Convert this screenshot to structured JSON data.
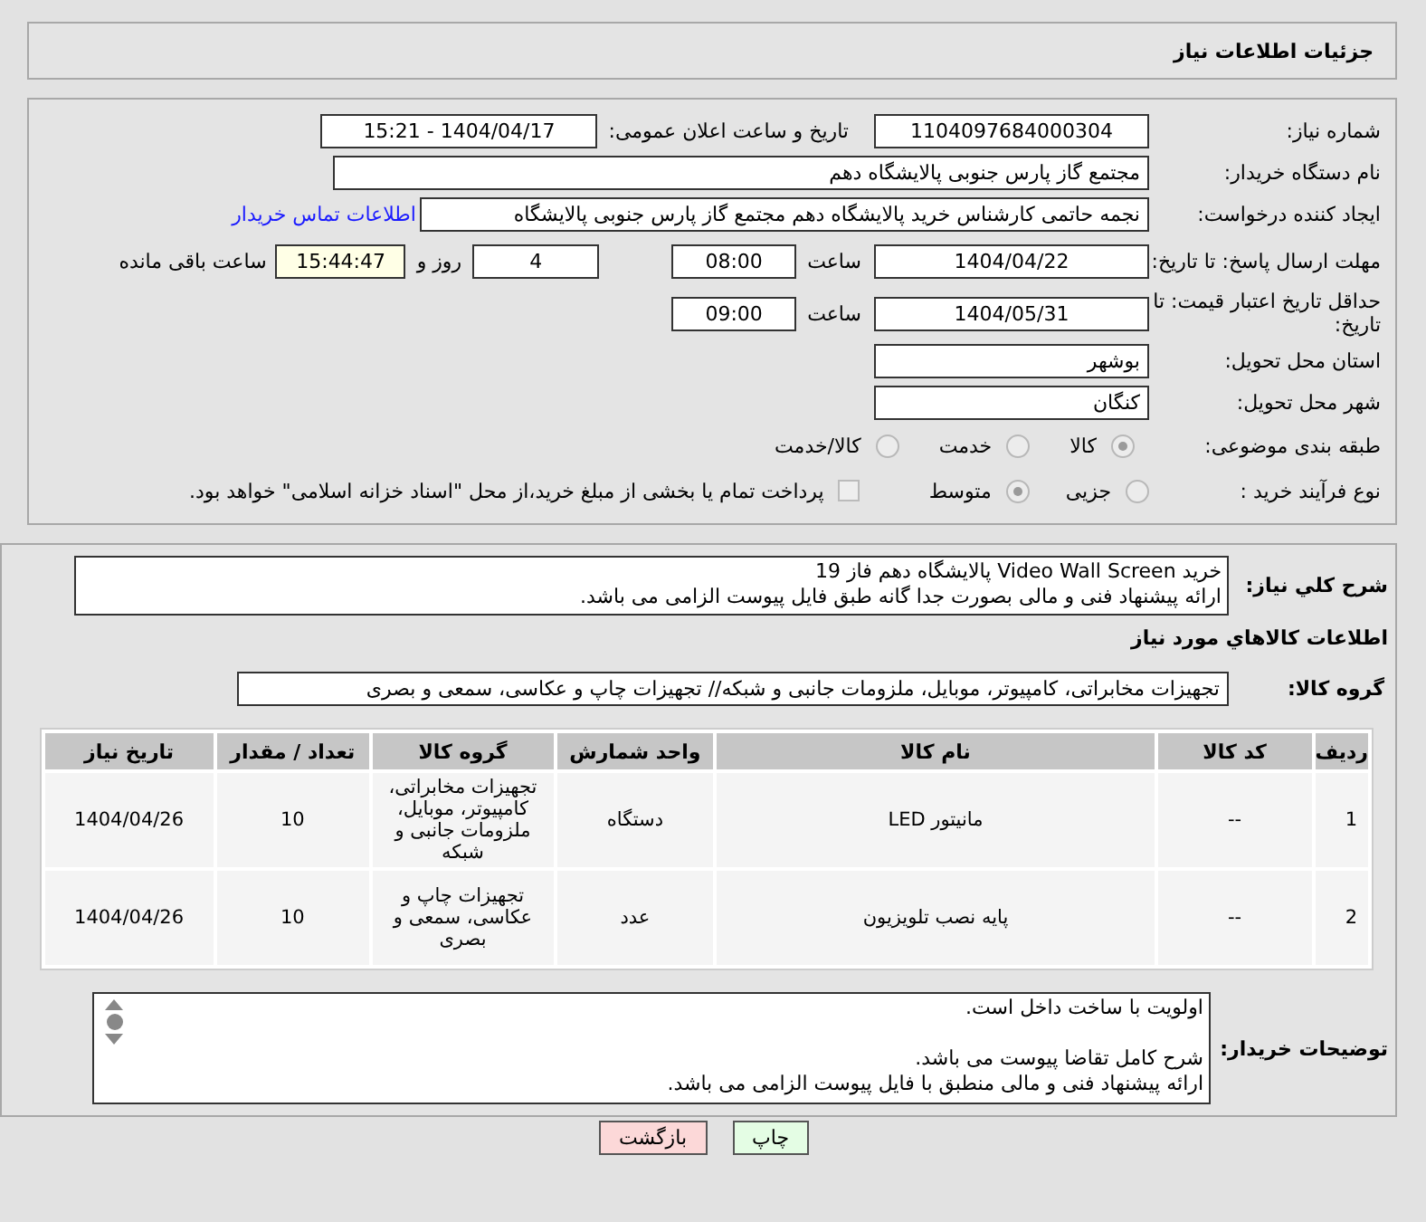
{
  "header": {
    "title": "جزئیات اطلاعات نیاز"
  },
  "details": {
    "need_number": {
      "label": "شماره نیاز:",
      "value": "1104097684000304"
    },
    "announce": {
      "label": "تاریخ و ساعت اعلان عمومی:",
      "value": "1404/04/17 - 15:21"
    },
    "buyer": {
      "label": "نام دستگاه خریدار:",
      "value": "مجتمع گاز پارس جنوبی  پالایشگاه دهم"
    },
    "creator": {
      "label": "ایجاد کننده درخواست:",
      "value": "نجمه حاتمی کارشناس خرید پالایشگاه دهم  مجتمع گاز پارس جنوبی  پالایشگاه",
      "link": "اطلاعات تماس خریدار"
    },
    "deadline": {
      "label": "مهلت ارسال پاسخ: تا تاریخ:",
      "date": "1404/04/22",
      "time_label": "ساعت",
      "time": "08:00",
      "days": "4",
      "days_label": "روز و",
      "remaining": "15:44:47",
      "remaining_label": "ساعت باقی مانده"
    },
    "validity": {
      "label": "حداقل تاریخ اعتبار قیمت: تا تاریخ:",
      "date": "1404/05/31",
      "time_label": "ساعت",
      "time": "09:00"
    },
    "province": {
      "label": "استان محل تحویل:",
      "value": "بوشهر"
    },
    "city": {
      "label": "شهر محل تحویل:",
      "value": "کنگان"
    },
    "category": {
      "label": "طبقه بندی موضوعی:",
      "options": [
        {
          "label": "کالا",
          "selected": true
        },
        {
          "label": "خدمت",
          "selected": false
        },
        {
          "label": "کالا/خدمت",
          "selected": false
        }
      ]
    },
    "process": {
      "label": "نوع فرآیند خرید :",
      "options": [
        {
          "label": "جزیی",
          "selected": false
        },
        {
          "label": "متوسط",
          "selected": true
        }
      ],
      "treasury": {
        "checked": false,
        "label": "پرداخت تمام یا بخشی از مبلغ خرید،از محل \"اسناد خزانه اسلامی\" خواهد بود."
      }
    }
  },
  "needs": {
    "description": {
      "label": "شرح کلي نياز:",
      "lines": [
        "خرید Video Wall Screen پالایشگاه دهم فاز 19",
        "ارائه پیشنهاد فنی و مالی بصورت جدا گانه طبق فایل پیوست الزامی می باشد."
      ]
    },
    "goods_title": "اطلاعات کالاهاي مورد نياز",
    "goods_group": {
      "label": "گروه کالا:",
      "value": "تجهیزات مخابراتی، کامپیوتر، موبایل، ملزومات جانبی و شبکه// تجهیزات چاپ و عکاسی، سمعی و بصری"
    },
    "table": {
      "columns": [
        "ردیف",
        "کد کالا",
        "نام کالا",
        "واحد شمارش",
        "گروه کالا",
        "تعداد / مقدار",
        "تاریخ نیاز"
      ],
      "rows": [
        [
          "1",
          "--",
          "مانیتور LED",
          "دستگاه",
          "تجهیزات مخابراتی، کامپیوتر، موبایل، ملزومات جانبی و شبکه",
          "10",
          "1404/04/26"
        ],
        [
          "2",
          "--",
          "پایه نصب تلویزیون",
          "عدد",
          "تجهیزات چاپ و عکاسی، سمعی و بصری",
          "10",
          "1404/04/26"
        ]
      ]
    },
    "buyer_notes": {
      "label": "توضیحات خریدار:",
      "paragraphs": [
        [
          "اولویت با ساخت داخل است."
        ],
        [
          "شرح کامل تقاضا پیوست می باشد.",
          "ارائه پیشنهاد فنی و مالی منطبق با فایل پیوست الزامی می باشد."
        ]
      ]
    }
  },
  "buttons": [
    {
      "label": "چاپ",
      "kind": "print"
    },
    {
      "label": "بازگشت",
      "kind": "back"
    }
  ]
}
